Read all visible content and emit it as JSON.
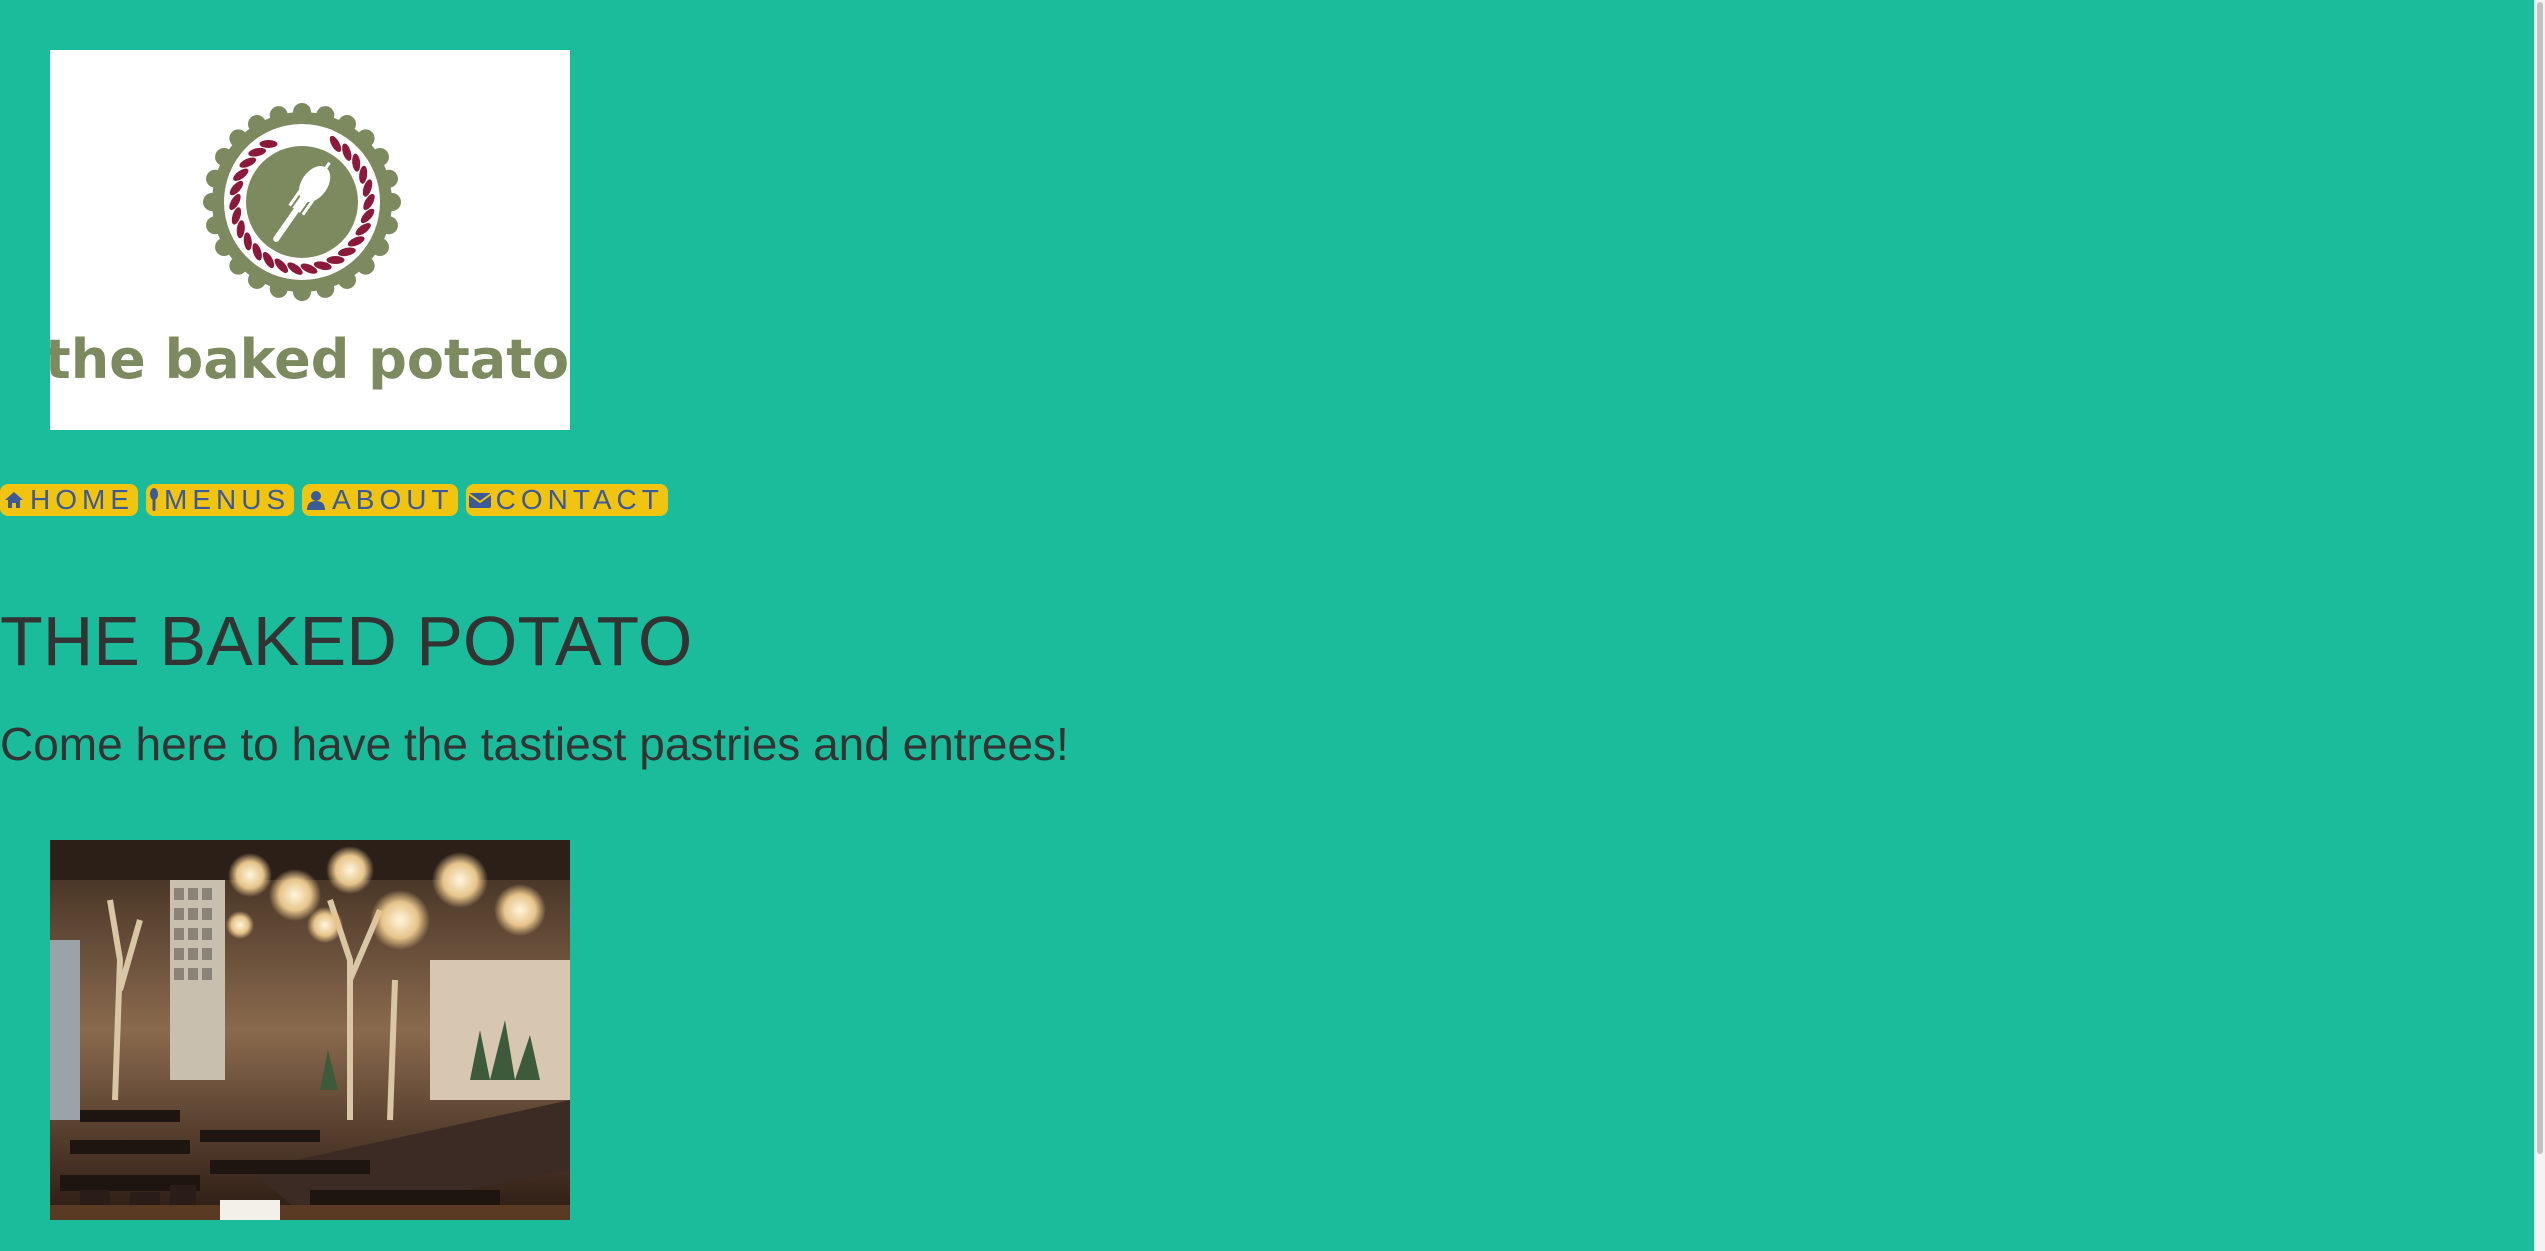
{
  "logo": {
    "brand_text": "the baked potato"
  },
  "nav": {
    "items": [
      {
        "label": "HOME",
        "icon": "home-icon"
      },
      {
        "label": "MENUS",
        "icon": "spoon-icon"
      },
      {
        "label": "ABOUT",
        "icon": "user-icon"
      },
      {
        "label": "CONTACT",
        "icon": "envelope-icon"
      }
    ]
  },
  "hero": {
    "title": "THE BAKED POTATO",
    "subtitle": "Come here to have the tastiest pastries and entrees!"
  },
  "colors": {
    "background": "#1abc9c",
    "nav_background": "#f1c40f",
    "nav_text": "#3c5a99",
    "heading_text": "#333333",
    "logo_green": "#7d8a60",
    "logo_maroon": "#8b1a3a"
  }
}
